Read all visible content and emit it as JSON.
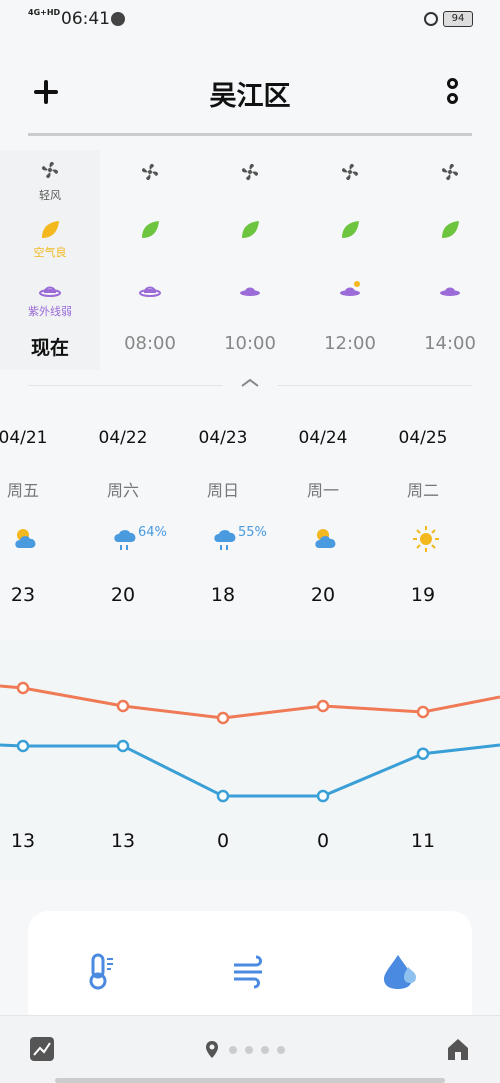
{
  "status": {
    "network": "4G+HD",
    "time": "06:41",
    "battery": "94"
  },
  "header": {
    "city": "吴江区",
    "add_icon": "plus-icon",
    "menu_icon": "more-vertical-icon"
  },
  "hourly": {
    "wind_label": "轻风",
    "air_label": "空气良",
    "uv_label": "紫外线弱",
    "times": [
      "现在",
      "08:00",
      "10:00",
      "12:00",
      "14:00"
    ],
    "colors": {
      "wind": "#555555",
      "air": "#f2b81e",
      "leaf": "#6cc43f",
      "uv": "#9b6bd8"
    }
  },
  "daily": [
    {
      "date": "04/21",
      "weekday": "周五",
      "icon": "partly-cloudy-icon",
      "precip": "",
      "high": "23",
      "low": "13"
    },
    {
      "date": "04/22",
      "weekday": "周六",
      "icon": "rain-icon",
      "precip": "64%",
      "high": "20",
      "low": "13"
    },
    {
      "date": "04/23",
      "weekday": "周日",
      "icon": "rain-icon",
      "precip": "55%",
      "high": "18",
      "low": "0"
    },
    {
      "date": "04/24",
      "weekday": "周一",
      "icon": "partly-cloudy-icon",
      "precip": "",
      "high": "20",
      "low": "0"
    },
    {
      "date": "04/25",
      "weekday": "周二",
      "icon": "sunny-icon",
      "precip": "",
      "high": "19",
      "low": "11"
    }
  ],
  "chart_data": {
    "type": "line",
    "categories": [
      "04/21",
      "04/22",
      "04/23",
      "04/24",
      "04/25"
    ],
    "series": [
      {
        "values": [
          23,
          20,
          18,
          20,
          19
        ],
        "color": "#ef7a55"
      },
      {
        "values": [
          13,
          13,
          0,
          0,
          11
        ],
        "color": "#3a9fd6"
      }
    ]
  },
  "details": {
    "temp_label": "体感",
    "wind_label": "风况",
    "humidity_label": "湿度"
  },
  "bottom_nav": {
    "trend_icon": "chart-trend-icon",
    "location_icon": "location-pin-icon",
    "home_icon": "home-icon"
  }
}
